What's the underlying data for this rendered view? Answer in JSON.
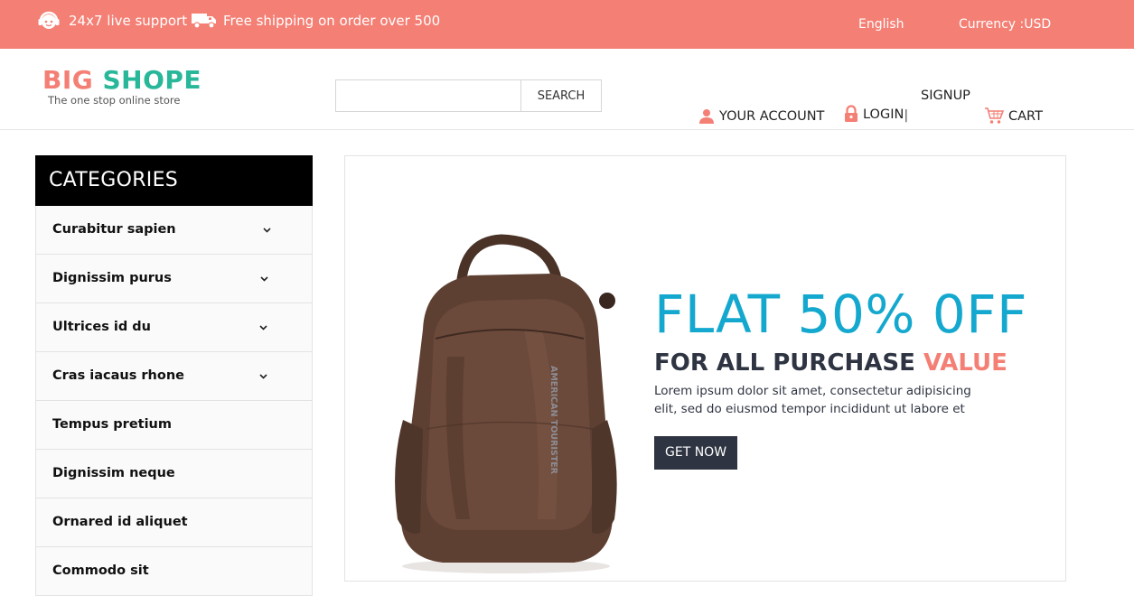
{
  "topbar": {
    "support": "24x7 live support",
    "shipping": "Free shipping on order over 500",
    "language": "English",
    "currency": "Currency :USD",
    "background": "#f47f74"
  },
  "logo": {
    "big": "BIG",
    "shope": "SHOPE",
    "tagline": "The one stop online store"
  },
  "search": {
    "placeholder": "",
    "button_label": "SEARCH"
  },
  "nav": {
    "account": "YOUR ACCOUNT",
    "login": "LOGIN",
    "separator": "|",
    "signup": "SIGNUP",
    "cart": "CART"
  },
  "categories": {
    "title": "CATEGORIES",
    "items": [
      {
        "label": "Curabitur sapien"
      },
      {
        "label": "Dignissim purus"
      },
      {
        "label": "Ultrices id du"
      },
      {
        "label": "Cras iacaus rhone"
      },
      {
        "label": "Tempus pretium"
      },
      {
        "label": "Dignissim neque"
      },
      {
        "label": "Ornared id aliquet"
      },
      {
        "label": "Commodo sit"
      }
    ]
  },
  "banner": {
    "headline": "FLAT 50% 0FF",
    "subheadline": "FOR ALL PURCHASE ",
    "subheadline_highlight": "VALUE",
    "description": "Lorem ipsum dolor sit amet, consectetur adipisicing elit, sed do eiusmod tempor incididunt ut labore et",
    "button_label": "GET NOW",
    "product_text": "AMERICAN TOURISTER"
  },
  "colors": {
    "accent": "#f47f74",
    "teal": "#29b79a",
    "headline_blue": "#15a8cf",
    "dark": "#2e3441"
  }
}
